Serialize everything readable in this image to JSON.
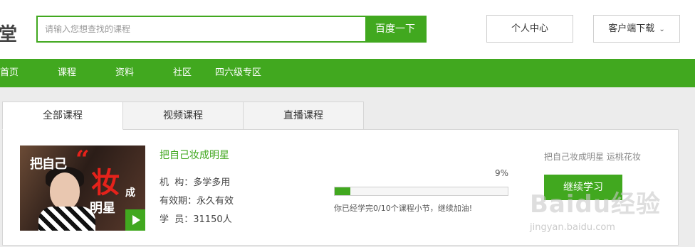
{
  "header": {
    "logo_fragment": "堂",
    "search": {
      "placeholder": "请输入您想查找的课程",
      "button_label": "百度一下"
    },
    "personal_center_label": "个人中心",
    "client_download_label": "客户端下载"
  },
  "nav": {
    "items": [
      {
        "label": "首页"
      },
      {
        "label": "课程"
      },
      {
        "label": "资料"
      },
      {
        "label": "社区"
      },
      {
        "label": "四六级专区"
      }
    ]
  },
  "tabs": [
    {
      "label": "全部课程",
      "active": true
    },
    {
      "label": "视频课程",
      "active": false
    },
    {
      "label": "直播课程",
      "active": false
    }
  ],
  "course": {
    "thumbnail_text": [
      "把自己",
      "妆",
      "成",
      "明星",
      "“"
    ],
    "title": "把自己妆成明星",
    "institution_label": "机  构：",
    "institution_value": "多学多用",
    "validity_label": "有效期：",
    "validity_value": "永久有效",
    "students_label": "学  员：",
    "students_value": "31150人",
    "progress_percent": 9,
    "progress_text": "9%",
    "progress_note": "你已经学完0/10个课程小节，继续加油!",
    "right_title": "把自己妆成明星 运桃花妆",
    "continue_label": "继续学习"
  },
  "watermark": {
    "brand": "Baidu经验",
    "url": "jingyan.baidu.com"
  },
  "colors": {
    "accent": "#41a81f",
    "content_bg": "#ececec"
  },
  "icons": {
    "dropdown": "chevron-down-icon",
    "play": "play-icon"
  }
}
